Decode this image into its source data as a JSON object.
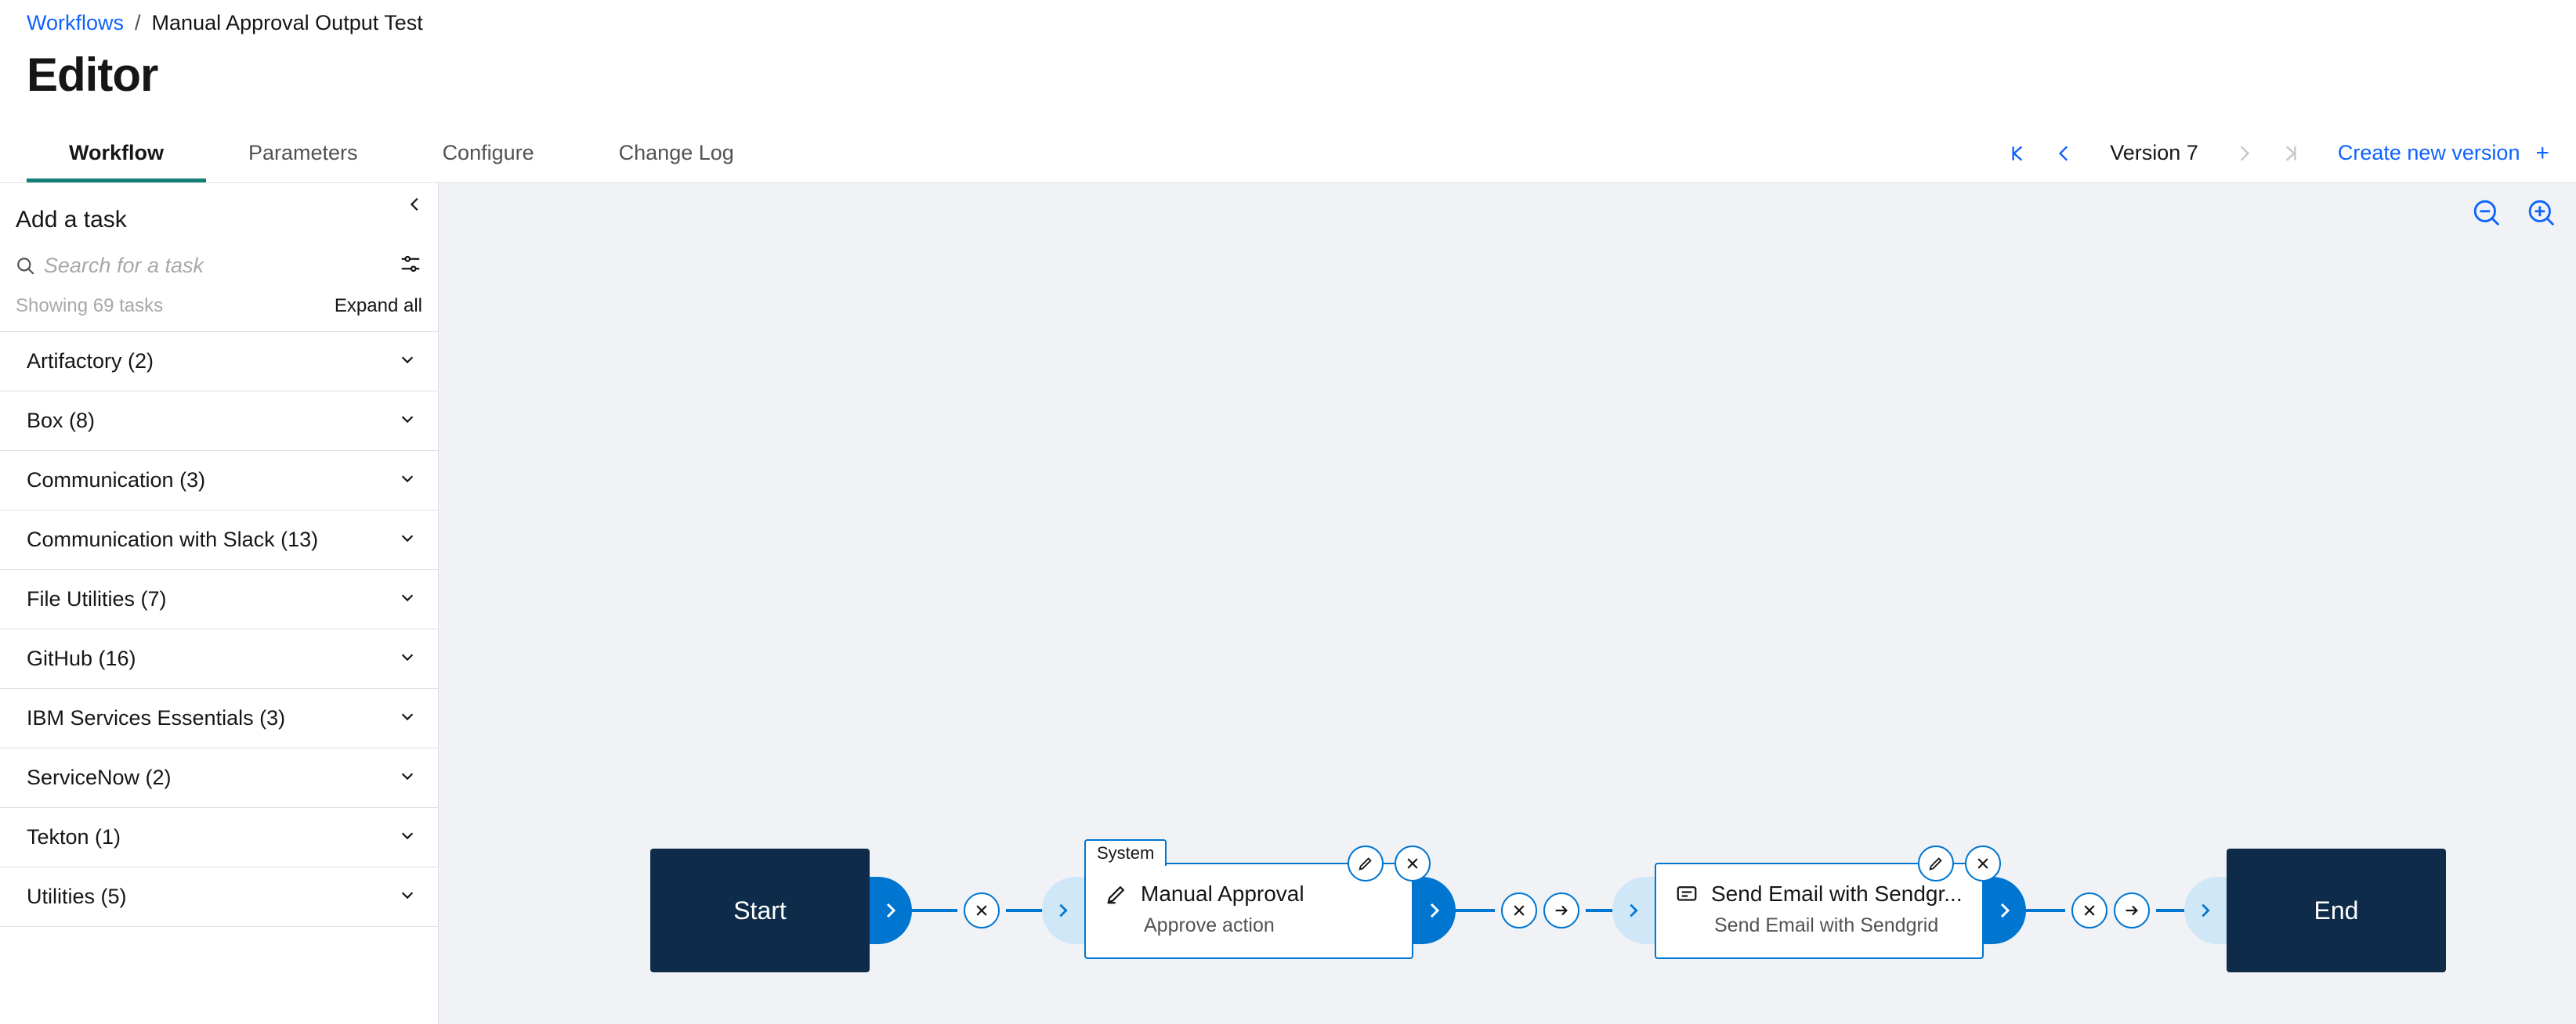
{
  "breadcrumb": {
    "root": "Workflows",
    "current": "Manual Approval Output Test"
  },
  "page_title": "Editor",
  "tabs": [
    {
      "label": "Workflow",
      "active": true
    },
    {
      "label": "Parameters"
    },
    {
      "label": "Configure"
    },
    {
      "label": "Change Log"
    }
  ],
  "version": {
    "label": "Version 7"
  },
  "create_version_label": "Create new version",
  "sidebar": {
    "title": "Add a task",
    "search_placeholder": "Search for a task",
    "count_label": "Showing 69 tasks",
    "expand_label": "Expand all",
    "categories": [
      {
        "label": "Artifactory (2)"
      },
      {
        "label": "Box (8)"
      },
      {
        "label": "Communication (3)"
      },
      {
        "label": "Communication with Slack (13)"
      },
      {
        "label": "File Utilities (7)"
      },
      {
        "label": "GitHub (16)"
      },
      {
        "label": "IBM Services Essentials (3)"
      },
      {
        "label": "ServiceNow (2)"
      },
      {
        "label": "Tekton (1)"
      },
      {
        "label": "Utilities (5)"
      }
    ]
  },
  "flow": {
    "start": "Start",
    "end": "End",
    "nodes": [
      {
        "tag": "System",
        "title": "Manual Approval",
        "subtitle": "Approve action",
        "icon": "edit"
      },
      {
        "tag": "",
        "title": "Send Email with Sendgr...",
        "subtitle": "Send Email with Sendgrid",
        "icon": "message"
      }
    ]
  }
}
